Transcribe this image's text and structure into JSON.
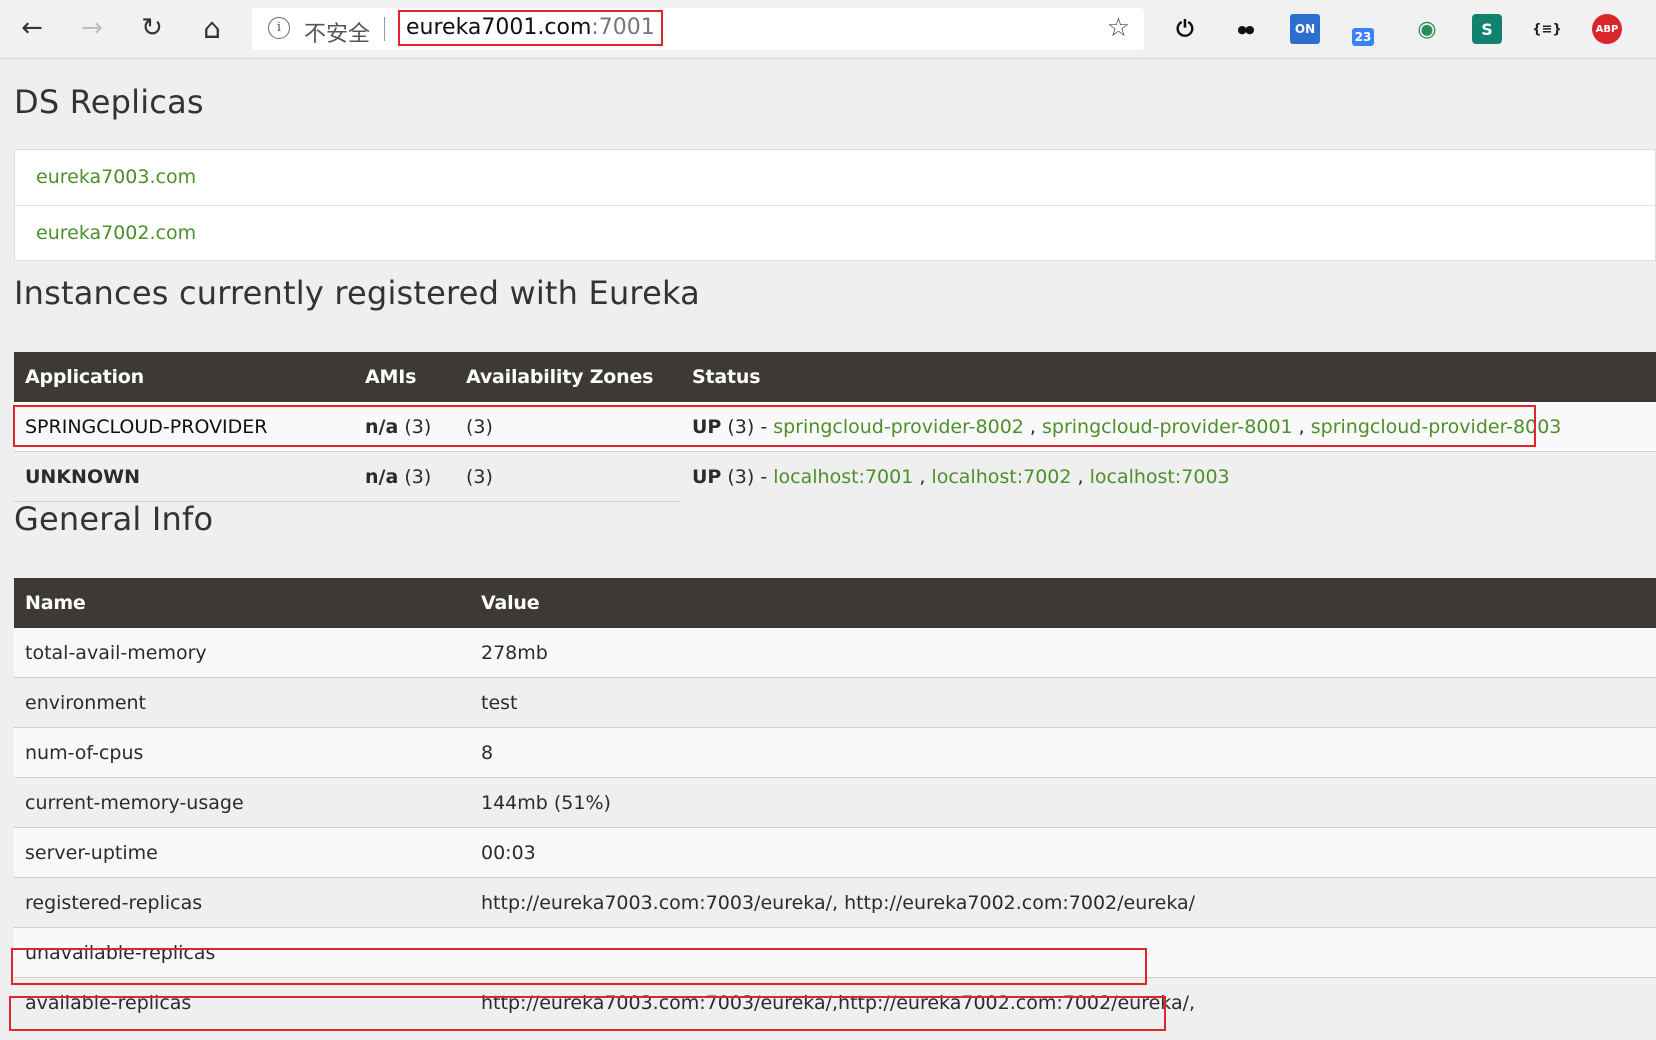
{
  "browser": {
    "back_label": "←",
    "forward_label": "→",
    "reload_label": "↻",
    "home_label": "⌂",
    "insecure_text": "不安全",
    "url_host": "eureka7001.com",
    "url_port": ":7001",
    "star_label": "☆",
    "extensions": [
      {
        "name": "power-icon",
        "glyph": "⏻"
      },
      {
        "name": "tampermonkey-icon",
        "glyph": "●●"
      },
      {
        "name": "ext-on-icon",
        "glyph": "ON"
      },
      {
        "name": "ext-cat-badge-icon",
        "glyph": "23"
      },
      {
        "name": "ext-globe-icon",
        "glyph": "◉"
      },
      {
        "name": "ext-s-icon",
        "glyph": "S"
      },
      {
        "name": "json-viewer-icon",
        "glyph": "{≡}"
      },
      {
        "name": "adblock-plus-icon",
        "glyph": "ABP"
      }
    ]
  },
  "ds_replicas": {
    "title": "DS Replicas",
    "items": [
      "eureka7003.com",
      "eureka7002.com"
    ]
  },
  "instances": {
    "title": "Instances currently registered with Eureka",
    "headers": [
      "Application",
      "AMIs",
      "Availability Zones",
      "Status"
    ],
    "rows": [
      {
        "application": "SPRINGCLOUD-PROVIDER",
        "amis_strong": "n/a",
        "amis_count": " (3)",
        "zones": "(3)",
        "status_strong": "UP",
        "status_count": " (3) - ",
        "links": [
          "springcloud-provider-8002",
          "springcloud-provider-8001",
          "springcloud-provider-8003"
        ]
      },
      {
        "application": "UNKNOWN",
        "amis_strong": "n/a",
        "amis_count": " (3)",
        "zones": "(3)",
        "status_strong": "UP",
        "status_count": " (3) - ",
        "links": [
          "localhost:7001",
          "localhost:7002",
          "localhost:7003"
        ]
      }
    ]
  },
  "general": {
    "title": "General Info",
    "headers": [
      "Name",
      "Value"
    ],
    "rows": [
      {
        "name": "total-avail-memory",
        "value": "278mb"
      },
      {
        "name": "environment",
        "value": "test"
      },
      {
        "name": "num-of-cpus",
        "value": "8"
      },
      {
        "name": "current-memory-usage",
        "value": "144mb (51%)"
      },
      {
        "name": "server-uptime",
        "value": "00:03"
      },
      {
        "name": "registered-replicas",
        "value": "http://eureka7003.com:7003/eureka/, http://eureka7002.com:7002/eureka/"
      },
      {
        "name": "unavailable-replicas",
        "value": ""
      },
      {
        "name": "available-replicas",
        "value": "http://eureka7003.com:7003/eureka/,http://eureka7002.com:7002/eureka/,"
      }
    ]
  },
  "colors": {
    "link": "#4d8f2a",
    "header_bg": "#3d3935",
    "highlight": "#e0262b"
  }
}
